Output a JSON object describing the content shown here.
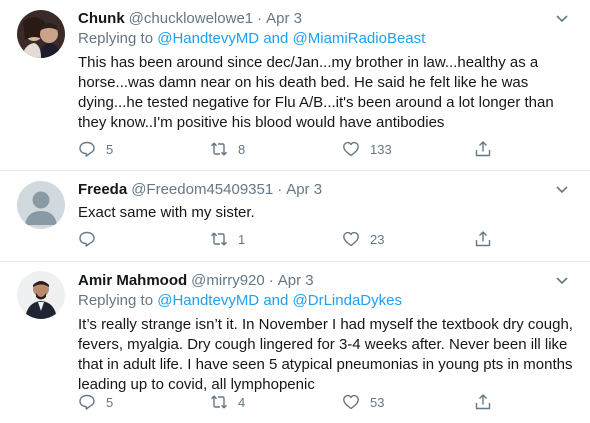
{
  "tweets": [
    {
      "name": "Chunk",
      "handle": "@chucklowelowe1",
      "dot": "·",
      "date": "Apr 3",
      "reply_prefix": "Replying to",
      "mention1": "@HandtevyMD",
      "reply_and": "and",
      "mention2": "@MiamiRadioBeast",
      "text": "This has been around since dec/Jan...my brother in law...healthy as a horse...was damn near on his death bed. He said he felt like he was dying...he tested negative for Flu A/B...it's been around a lot longer than they know..I'm positive his blood would have antibodies",
      "replies": "5",
      "retweets": "8",
      "likes": "133"
    },
    {
      "name": "Freeda",
      "handle": "@Freedom45409351",
      "dot": "·",
      "date": "Apr 3",
      "text": "Exact same with my sister.",
      "replies": "",
      "retweets": "1",
      "likes": "23"
    },
    {
      "name": "Amir Mahmood",
      "handle": "@mirry920",
      "dot": "·",
      "date": "Apr 3",
      "reply_prefix": "Replying to",
      "mention1": "@HandtevyMD",
      "reply_and": "and",
      "mention2": "@DrLindaDykes",
      "text": "It’s really strange isn’t it. In November I had myself the textbook dry cough, fevers, myalgia. Dry cough lingered for 3-4 weeks after. Never been ill like that in adult life. I have seen 5 atypical pneumonias in young pts in months leading up to covid, all lymphopenic",
      "replies": "5",
      "retweets": "4",
      "likes": "53"
    }
  ],
  "icons": {
    "reply": "reply-icon",
    "retweet": "retweet-icon",
    "like": "heart-icon",
    "share": "share-icon",
    "caret": "chevron-down-icon"
  },
  "colors": {
    "link": "#1da1f2",
    "muted": "#657786",
    "text": "#14171a",
    "divider": "#e6ecf0"
  }
}
